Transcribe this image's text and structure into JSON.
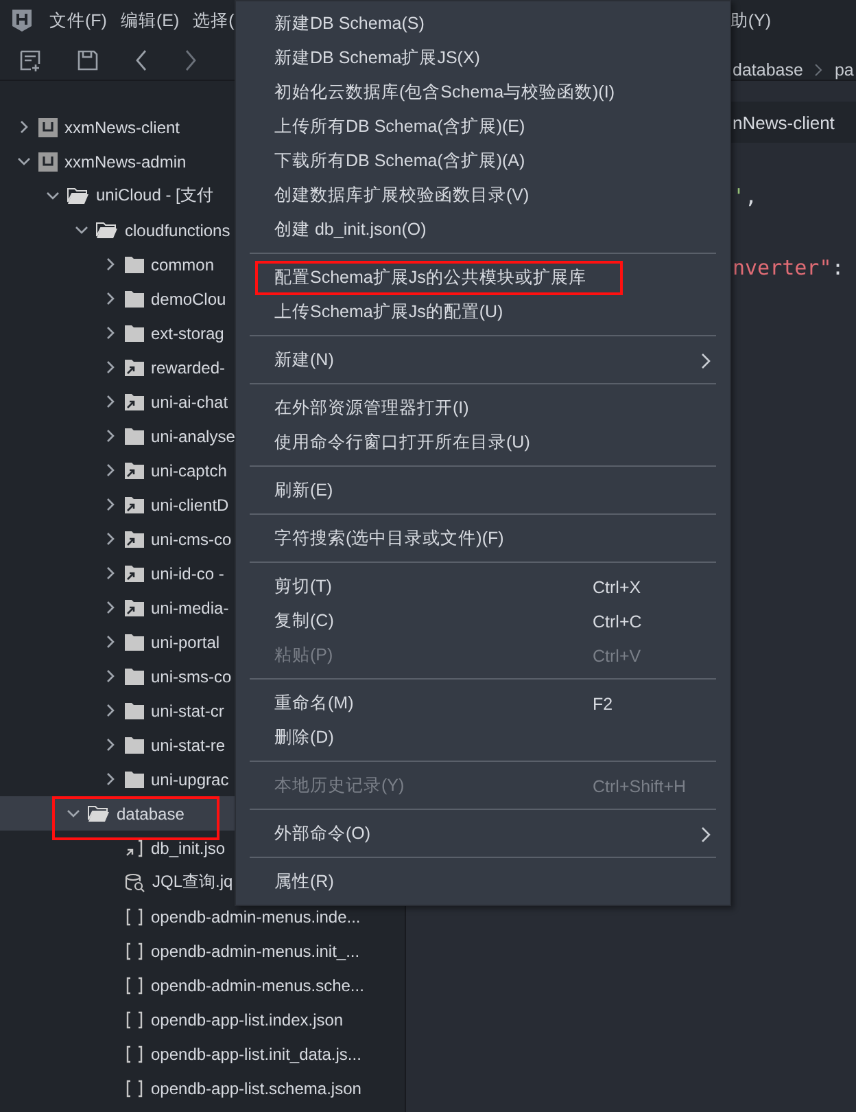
{
  "menubar": {
    "items": [
      {
        "label": "文件(F)"
      },
      {
        "label": "编辑(E)"
      },
      {
        "label": "选择("
      }
    ],
    "trailing": "助(Y)"
  },
  "toolbar": {
    "buttons": [
      {
        "kind": "new-file"
      },
      {
        "kind": "save"
      },
      {
        "kind": "back"
      },
      {
        "kind": "forward"
      }
    ]
  },
  "tree": [
    {
      "label": "xxmNews-client",
      "kind": "project",
      "expanded": false,
      "selected": false
    },
    {
      "label": "xxmNews-admin",
      "kind": "project",
      "expanded": true,
      "selected": false,
      "children": [
        {
          "label": "uniCloud - [支付",
          "kind": "folder-open",
          "expanded": true,
          "selected": false,
          "children": [
            {
              "label": "cloudfunctions",
              "kind": "folder-open",
              "expanded": true,
              "selected": false,
              "children": [
                {
                  "label": "common",
                  "kind": "folder",
                  "expanded": false,
                  "selected": false
                },
                {
                  "label": "demoClou",
                  "kind": "folder",
                  "expanded": false,
                  "selected": false
                },
                {
                  "label": "ext-storag",
                  "kind": "folder",
                  "expanded": false,
                  "selected": false
                },
                {
                  "label": "rewarded-",
                  "kind": "folder-link",
                  "expanded": false,
                  "selected": false
                },
                {
                  "label": "uni-ai-chat",
                  "kind": "folder-link",
                  "expanded": false,
                  "selected": false
                },
                {
                  "label": "uni-analyse",
                  "kind": "folder",
                  "expanded": false,
                  "selected": false
                },
                {
                  "label": "uni-captch",
                  "kind": "folder-link",
                  "expanded": false,
                  "selected": false
                },
                {
                  "label": "uni-clientD",
                  "kind": "folder-link",
                  "expanded": false,
                  "selected": false
                },
                {
                  "label": "uni-cms-co",
                  "kind": "folder-link",
                  "expanded": false,
                  "selected": false
                },
                {
                  "label": "uni-id-co -",
                  "kind": "folder-link",
                  "expanded": false,
                  "selected": false
                },
                {
                  "label": "uni-media-",
                  "kind": "folder-link",
                  "expanded": false,
                  "selected": false
                },
                {
                  "label": "uni-portal",
                  "kind": "folder",
                  "expanded": false,
                  "selected": false
                },
                {
                  "label": "uni-sms-co",
                  "kind": "folder",
                  "expanded": false,
                  "selected": false
                },
                {
                  "label": "uni-stat-cr",
                  "kind": "folder",
                  "expanded": false,
                  "selected": false
                },
                {
                  "label": "uni-stat-re",
                  "kind": "folder",
                  "expanded": false,
                  "selected": false
                },
                {
                  "label": "uni-upgrac",
                  "kind": "folder",
                  "expanded": false,
                  "selected": false
                }
              ]
            },
            {
              "label": "database",
              "kind": "folder-open",
              "expanded": true,
              "selected": true,
              "highlighted": true,
              "children": [
                {
                  "label": "db_init.jso",
                  "kind": "file-init",
                  "selected": false
                },
                {
                  "label": "JQL查询.jq",
                  "kind": "file-jql",
                  "selected": false
                },
                {
                  "label": "opendb-admin-menus.inde...",
                  "kind": "file-json",
                  "selected": false
                },
                {
                  "label": "opendb-admin-menus.init_...",
                  "kind": "file-json",
                  "selected": false
                },
                {
                  "label": "opendb-admin-menus.sche...",
                  "kind": "file-json",
                  "selected": false
                },
                {
                  "label": "opendb-app-list.index.json",
                  "kind": "file-json",
                  "selected": false
                },
                {
                  "label": "opendb-app-list.init_data.js...",
                  "kind": "file-json",
                  "selected": false
                },
                {
                  "label": "opendb-app-list.schema.json",
                  "kind": "file-json",
                  "selected": false
                }
              ]
            }
          ]
        }
      ]
    }
  ],
  "editor": {
    "breadcrumb": [
      "database",
      "pa"
    ],
    "tab": "nNews-client",
    "code": [
      [
        {
          "text": "'",
          "kind": "string"
        },
        {
          "text": ",",
          "kind": "punct"
        }
      ],
      [
        {
          "text": "nverter\"",
          "kind": "key"
        },
        {
          "text": ":",
          "kind": "punct"
        }
      ]
    ]
  },
  "context_menu": [
    {
      "kind": "item",
      "label": "新建DB Schema(S)"
    },
    {
      "kind": "item",
      "label": "新建DB Schema扩展JS(X)"
    },
    {
      "kind": "item",
      "label": "初始化云数据库(包含Schema与校验函数)(I)"
    },
    {
      "kind": "item",
      "label": "上传所有DB Schema(含扩展)(E)"
    },
    {
      "kind": "item",
      "label": "下载所有DB Schema(含扩展)(A)"
    },
    {
      "kind": "item",
      "label": "创建数据库扩展校验函数目录(V)"
    },
    {
      "kind": "item",
      "label": "创建 db_init.json(O)"
    },
    {
      "kind": "separator"
    },
    {
      "kind": "item",
      "label": "配置Schema扩展Js的公共模块或扩展库",
      "highlighted": true
    },
    {
      "kind": "item",
      "label": "上传Schema扩展Js的配置(U)"
    },
    {
      "kind": "separator"
    },
    {
      "kind": "item",
      "label": "新建(N)",
      "submenu": true
    },
    {
      "kind": "separator"
    },
    {
      "kind": "item",
      "label": "在外部资源管理器打开(I)"
    },
    {
      "kind": "item",
      "label": "使用命令行窗口打开所在目录(U)"
    },
    {
      "kind": "separator"
    },
    {
      "kind": "item",
      "label": "刷新(E)"
    },
    {
      "kind": "separator"
    },
    {
      "kind": "item",
      "label": "字符搜索(选中目录或文件)(F)"
    },
    {
      "kind": "separator"
    },
    {
      "kind": "item",
      "label": "剪切(T)",
      "shortcut": "Ctrl+X"
    },
    {
      "kind": "item",
      "label": "复制(C)",
      "shortcut": "Ctrl+C"
    },
    {
      "kind": "item",
      "label": "粘贴(P)",
      "shortcut": "Ctrl+V",
      "disabled": true
    },
    {
      "kind": "separator"
    },
    {
      "kind": "item",
      "label": "重命名(M)",
      "shortcut": "F2"
    },
    {
      "kind": "item",
      "label": "删除(D)"
    },
    {
      "kind": "separator"
    },
    {
      "kind": "item",
      "label": "本地历史记录(Y)",
      "shortcut": "Ctrl+Shift+H",
      "disabled": true
    },
    {
      "kind": "separator"
    },
    {
      "kind": "item",
      "label": "外部命令(O)",
      "submenu": true
    },
    {
      "kind": "separator"
    },
    {
      "kind": "item",
      "label": "属性(R)"
    }
  ]
}
